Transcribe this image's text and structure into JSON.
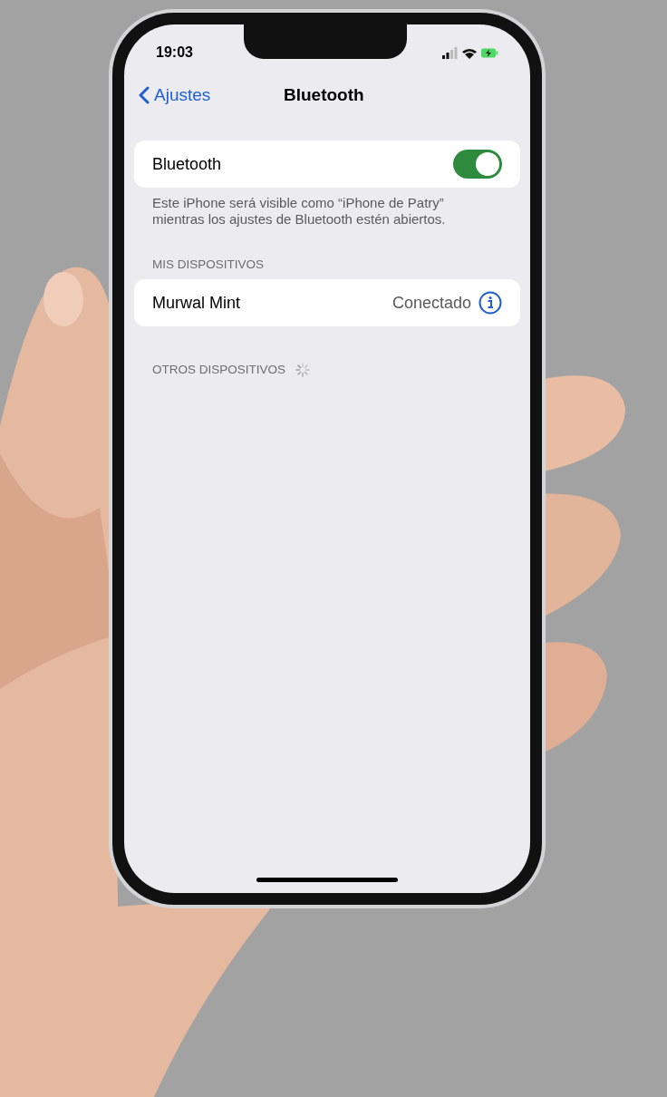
{
  "status_bar": {
    "time": "19:03"
  },
  "nav": {
    "back_label": "Ajustes",
    "title": "Bluetooth"
  },
  "bluetooth": {
    "label": "Bluetooth",
    "on": true
  },
  "footer": "Este iPhone será visible como “iPhone de Patry” mientras los ajustes de Bluetooth estén abiertos.",
  "my_devices": {
    "header": "MIS DISPOSITIVOS",
    "devices": [
      {
        "name": "Murwal Mint",
        "status": "Conectado"
      }
    ]
  },
  "other_devices": {
    "header": "OTROS DISPOSITIVOS",
    "searching": true
  }
}
